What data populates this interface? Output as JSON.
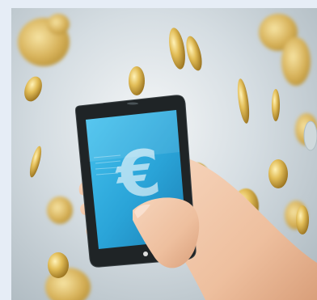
{
  "scene": {
    "subject": "hand-holding-smartphone",
    "screen_symbol": "€",
    "colors": {
      "frame_background": "#e6edf6",
      "screen_blue": "#2aa4d8",
      "screen_blue_dark": "#1b7fb4",
      "phone_body": "#1f2426",
      "coin_gold": "#d8b24a",
      "skin": "#f0c7a8"
    }
  }
}
